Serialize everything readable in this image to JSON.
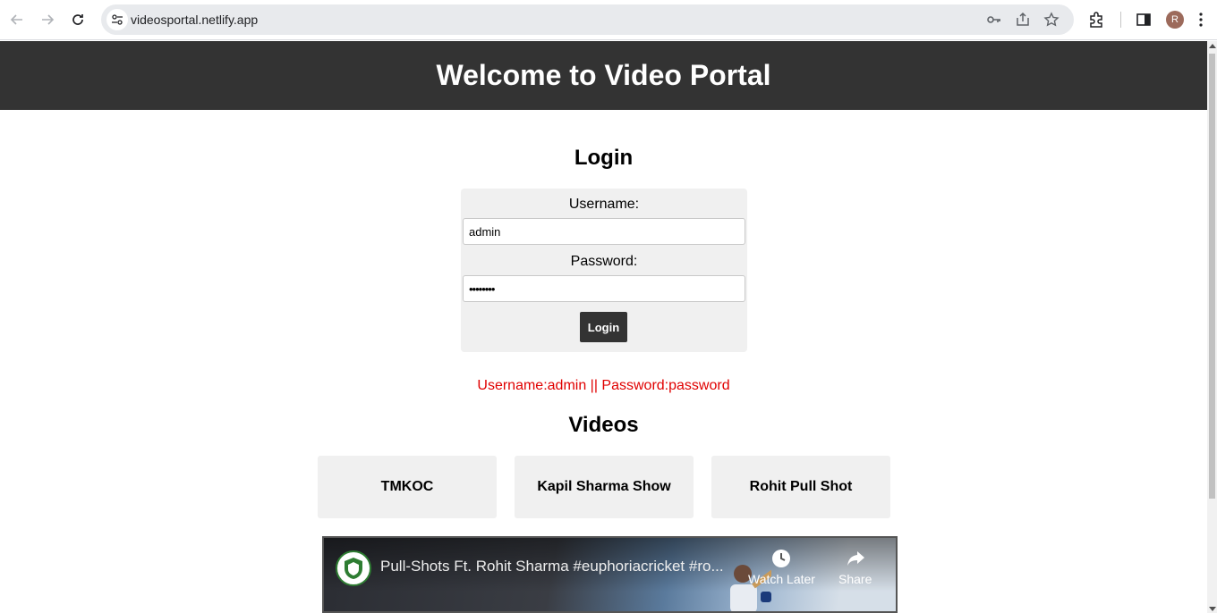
{
  "browser": {
    "url": "videosportal.netlify.app",
    "profile_initial": "R",
    "icons": [
      "back-icon",
      "forward-icon",
      "reload-icon",
      "site-info-icon",
      "key-icon",
      "share-icon",
      "star-icon",
      "extensions-icon",
      "side-panel-icon",
      "menu-icon"
    ]
  },
  "header": {
    "title": "Welcome to Video Portal"
  },
  "login": {
    "title": "Login",
    "username_label": "Username:",
    "username_value": "admin",
    "password_label": "Password:",
    "password_value": "••••••••",
    "button_label": "Login"
  },
  "hint": {
    "text": "Username:admin || Password:password"
  },
  "videos": {
    "title": "Videos",
    "items": [
      {
        "label": "TMKOC"
      },
      {
        "label": "Kapil Sharma Show"
      },
      {
        "label": "Rohit Pull Shot"
      }
    ]
  },
  "player": {
    "video_title": "Pull-Shots Ft. Rohit Sharma #euphoriacricket #ro...",
    "watch_later_label": "Watch Later",
    "share_label": "Share"
  },
  "colors": {
    "header_bg": "#333333",
    "hint": "#e00000",
    "panel_bg": "#f0f0f0"
  }
}
